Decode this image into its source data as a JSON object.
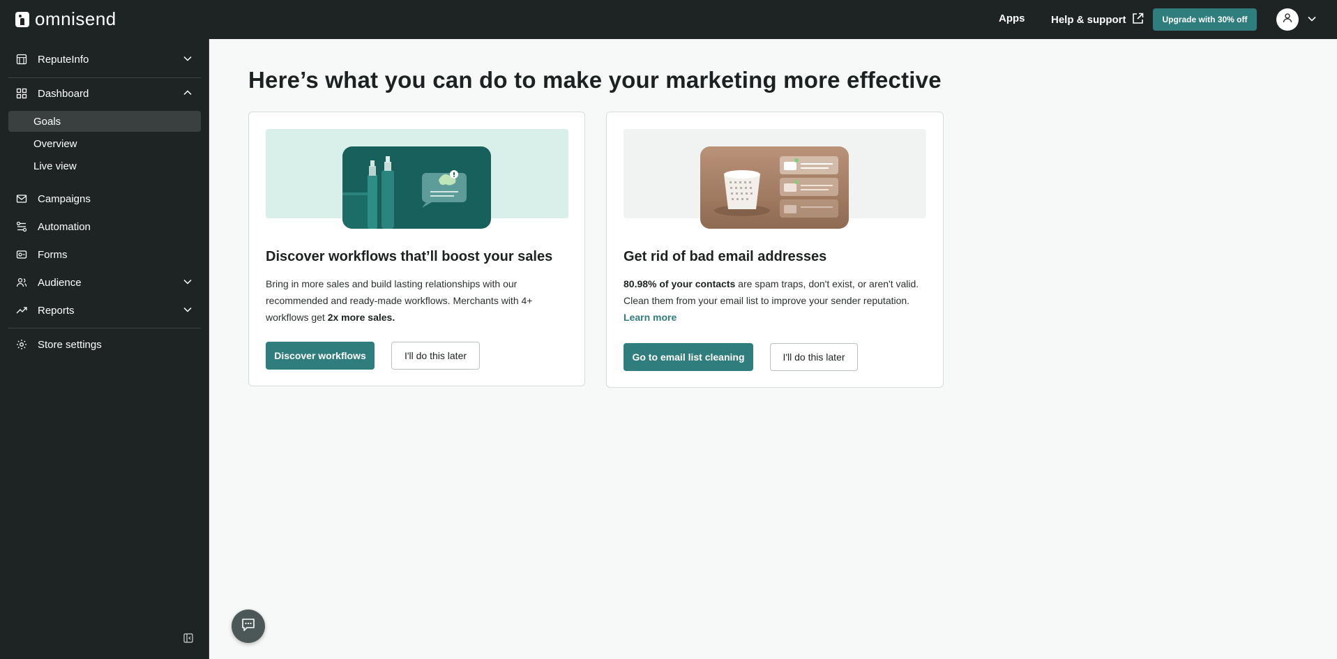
{
  "app": {
    "logo_text": "omnisend"
  },
  "topbar": {
    "apps_label": "Apps",
    "help_label": "Help & support",
    "upgrade_label": "Upgrade with 30% off"
  },
  "sidebar": {
    "store_label": "ReputeInfo",
    "dashboard_label": "Dashboard",
    "sub_items": [
      "Goals",
      "Overview",
      "Live view"
    ],
    "items": [
      "Campaigns",
      "Automation",
      "Forms",
      "Audience",
      "Reports"
    ],
    "store_settings_label": "Store settings"
  },
  "main": {
    "title": "Here’s what you can do to make your marketing more effective",
    "card1": {
      "title": "Discover workflows that’ll boost your sales",
      "body_line1": "Bring in more sales and build lasting relationships with our",
      "body_line2": "recommended and ready-made workflows. Merchants with 4+",
      "body_line3_prefix": "workflows get ",
      "body_line3_bold": "2x more sales.",
      "primary_label": "Discover workflows",
      "secondary_label": "I'll do this later"
    },
    "card2": {
      "title": "Get rid of bad email addresses",
      "body_bold": "80.98% of your contacts",
      "body_rest": " are spam traps, don't exist, or aren't valid.",
      "body_line2": "Clean them from your email list to improve your sender reputation.",
      "learn_more": "Learn more",
      "primary_label": "Go to email list cleaning",
      "secondary_label": "I'll do this later"
    }
  },
  "colors": {
    "accent": "#2f7d7c",
    "dark": "#1e2424",
    "active_item": "#3a4040"
  }
}
